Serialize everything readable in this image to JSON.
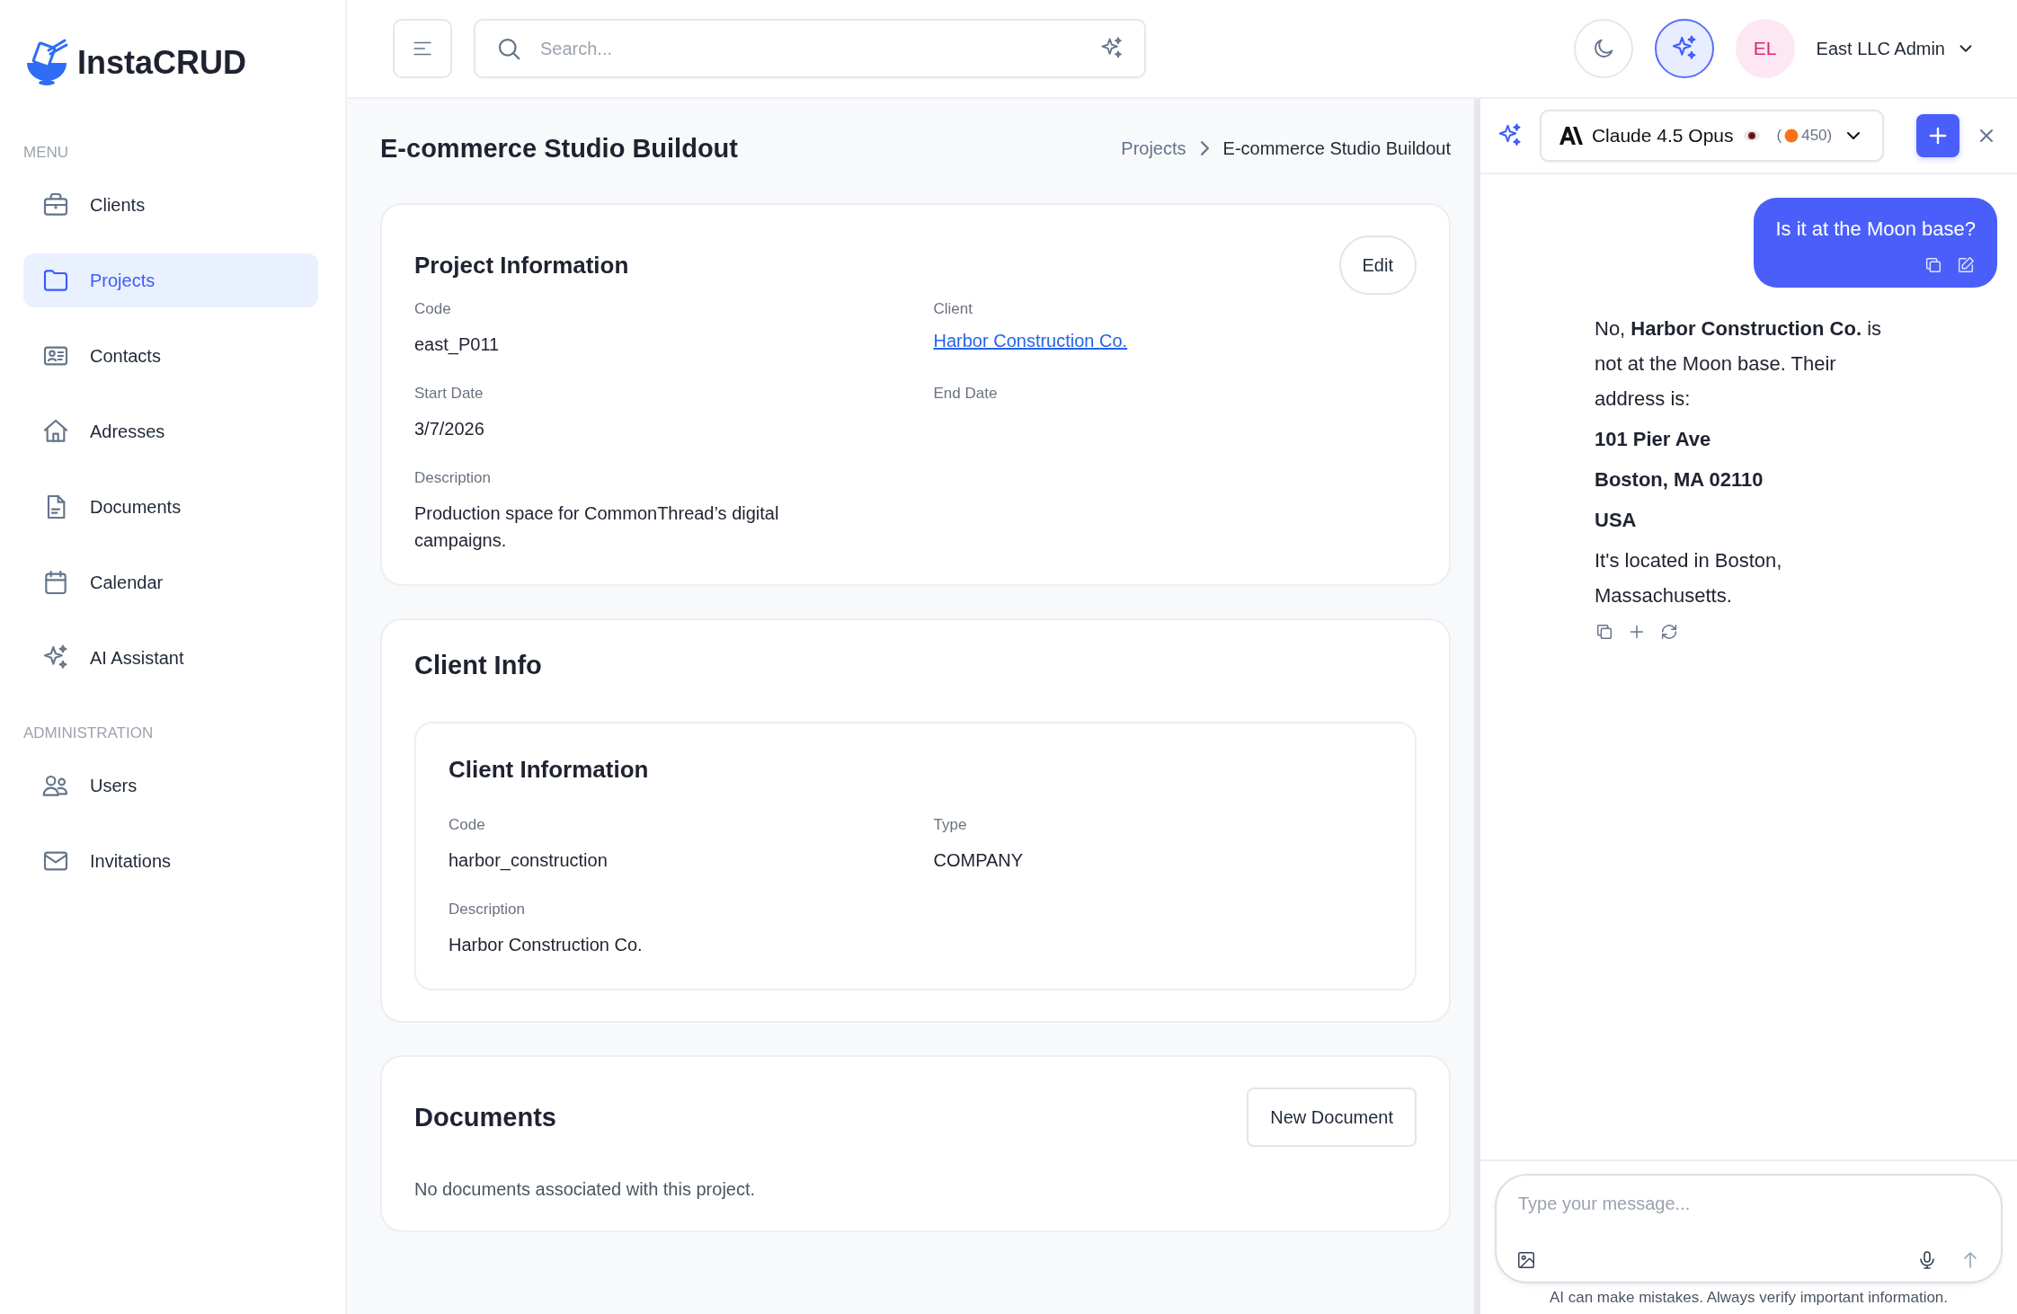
{
  "sidebar": {
    "logo": "InstaCRUD",
    "sections": [
      {
        "heading": "MENU",
        "items": [
          {
            "label": "Clients",
            "selected": false
          },
          {
            "label": "Projects",
            "selected": true
          },
          {
            "label": "Contacts",
            "selected": false
          },
          {
            "label": "Adresses",
            "selected": false
          },
          {
            "label": "Documents",
            "selected": false
          },
          {
            "label": "Calendar",
            "selected": false
          },
          {
            "label": "AI Assistant",
            "selected": false
          }
        ]
      },
      {
        "heading": "ADMINISTRATION",
        "items": [
          {
            "label": "Users",
            "selected": false
          },
          {
            "label": "Invitations",
            "selected": false
          }
        ]
      }
    ]
  },
  "topbar": {
    "search": {
      "placeholder": "Search..."
    },
    "assistant_button": {
      "on": true
    },
    "user": {
      "initials": "EL",
      "name": "East LLC Admin"
    }
  },
  "page": {
    "title": "E-commerce Studio Buildout",
    "breadcrumb": [
      "Projects",
      "E-commerce Studio Buildout"
    ]
  },
  "project_card": {
    "title": "Project Information",
    "edit_button": "Edit",
    "fields": [
      {
        "label": "Code",
        "value": "east_P011",
        "kind": "text"
      },
      {
        "label": "Client",
        "value": "Harbor Construction Co.",
        "kind": "link"
      },
      {
        "label": "Start Date",
        "value": "3/7/2026",
        "kind": "text"
      },
      {
        "label": "End Date"
      },
      {
        "label": "Description",
        "value": "Production space for CommonThread’s digital campaigns.",
        "kind": "text"
      }
    ]
  },
  "client_card": {
    "title": "Client Info",
    "inner_title": "Client Information",
    "fields": [
      {
        "label": "Code",
        "value": "harbor_construction",
        "kind": "text"
      },
      {
        "label": "Type",
        "value": "COMPANY",
        "kind": "text"
      },
      {
        "label": "Description",
        "value": "Harbor Construction Co.",
        "kind": "text"
      }
    ]
  },
  "documents_card": {
    "title": "Documents",
    "new_button": "New Document",
    "empty_text": "No documents associated with this project."
  },
  "chat": {
    "model": {
      "name": "Claude 4.5 Opus",
      "open": "(",
      "credits": "450",
      "close": ")"
    },
    "user_message": {
      "text": "Is it at the Moon base?"
    },
    "assistant_message": {
      "paragraphs": [
        {
          "text": "No, **Harbor Construction Co.** is not at the Moon base. Their address is:",
          "kind": "plain"
        },
        {
          "text": "101 Pier Ave",
          "kind": "bold"
        },
        {
          "text": "Boston, MA 02110",
          "kind": "bold"
        },
        {
          "text": "USA",
          "kind": "bold"
        },
        {
          "text": "It's located in Boston, Massachusetts.",
          "kind": "plain"
        }
      ]
    },
    "input": {
      "placeholder": "Type your message..."
    },
    "disclaimer": "AI can make mistakes. Always verify important information."
  }
}
